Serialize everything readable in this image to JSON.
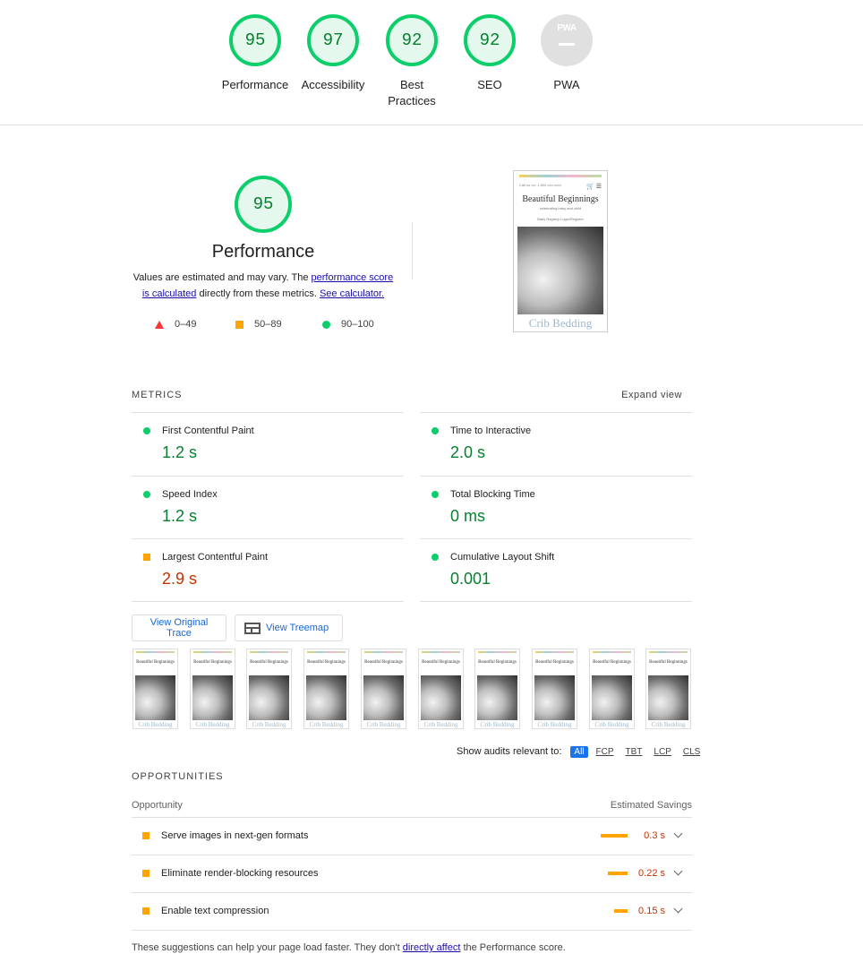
{
  "gauges": [
    {
      "score": "95",
      "label": "Performance"
    },
    {
      "score": "97",
      "label": "Accessibility"
    },
    {
      "score": "92",
      "label": "Best Practices"
    },
    {
      "score": "92",
      "label": "SEO"
    },
    {
      "score": "",
      "label": "PWA",
      "badge": "PWA"
    }
  ],
  "summary": {
    "score": "95",
    "title": "Performance",
    "desc_prefix": "Values are estimated and may vary. The",
    "link1": "performance score is calculated",
    "desc_middle": "directly from these metrics.",
    "link2": "See calculator.",
    "legend": [
      {
        "range": "0–49",
        "shape": "triangle",
        "color": "#ff3333"
      },
      {
        "range": "50–89",
        "shape": "square",
        "color": "#ffa400"
      },
      {
        "range": "90–100",
        "shape": "circle",
        "color": "#0cce6b"
      }
    ]
  },
  "screenshot": {
    "header_left": "Call us on: 1-800-xxx-xxxx",
    "brand": "Beautiful Beginnings",
    "tagline": "celebrating baby and child",
    "nav": "Baby Registry    Login/Register",
    "caption": "Crib Bedding"
  },
  "metrics": {
    "label": "METRICS",
    "expand": "Expand view",
    "items": [
      {
        "name": "First Contentful Paint",
        "value": "1.2 s",
        "status": "pass"
      },
      {
        "name": "Time to Interactive",
        "value": "2.0 s",
        "status": "pass"
      },
      {
        "name": "Speed Index",
        "value": "1.2 s",
        "status": "pass"
      },
      {
        "name": "Total Blocking Time",
        "value": "0 ms",
        "status": "pass"
      },
      {
        "name": "Largest Contentful Paint",
        "value": "2.9 s",
        "status": "average"
      },
      {
        "name": "Cumulative Layout Shift",
        "value": "0.001",
        "status": "pass"
      }
    ]
  },
  "buttons": {
    "trace": "View Original Trace",
    "treemap": "View Treemap"
  },
  "filmstrip": {
    "frames": 10,
    "brand": "Beautiful Beginnings",
    "caption": "Crib Bedding"
  },
  "filter": {
    "label": "Show audits relevant to:",
    "chips": [
      "All",
      "FCP",
      "TBT",
      "LCP",
      "CLS"
    ],
    "active": "All"
  },
  "opportunities": {
    "title": "OPPORTUNITIES",
    "col_left": "Opportunity",
    "col_right": "Estimated Savings",
    "rows": [
      {
        "name": "Serve images in next-gen formats",
        "savings": "0.3 s",
        "savings_seconds": 0.3
      },
      {
        "name": "Eliminate render-blocking resources",
        "savings": "0.22 s",
        "savings_seconds": 0.22
      },
      {
        "name": "Enable text compression",
        "savings": "0.15 s",
        "savings_seconds": 0.15
      }
    ]
  },
  "footer": {
    "prefix": "These suggestions can help your page load faster. They don't",
    "link": "directly affect",
    "suffix": "the Performance score."
  },
  "colors": {
    "pass": "#0cce6b",
    "pass_text": "#08802f",
    "average": "#ffa400",
    "average_text": "#c33300",
    "fail": "#ff3333",
    "link": "#1a0dab",
    "accent": "#1a73e8"
  }
}
